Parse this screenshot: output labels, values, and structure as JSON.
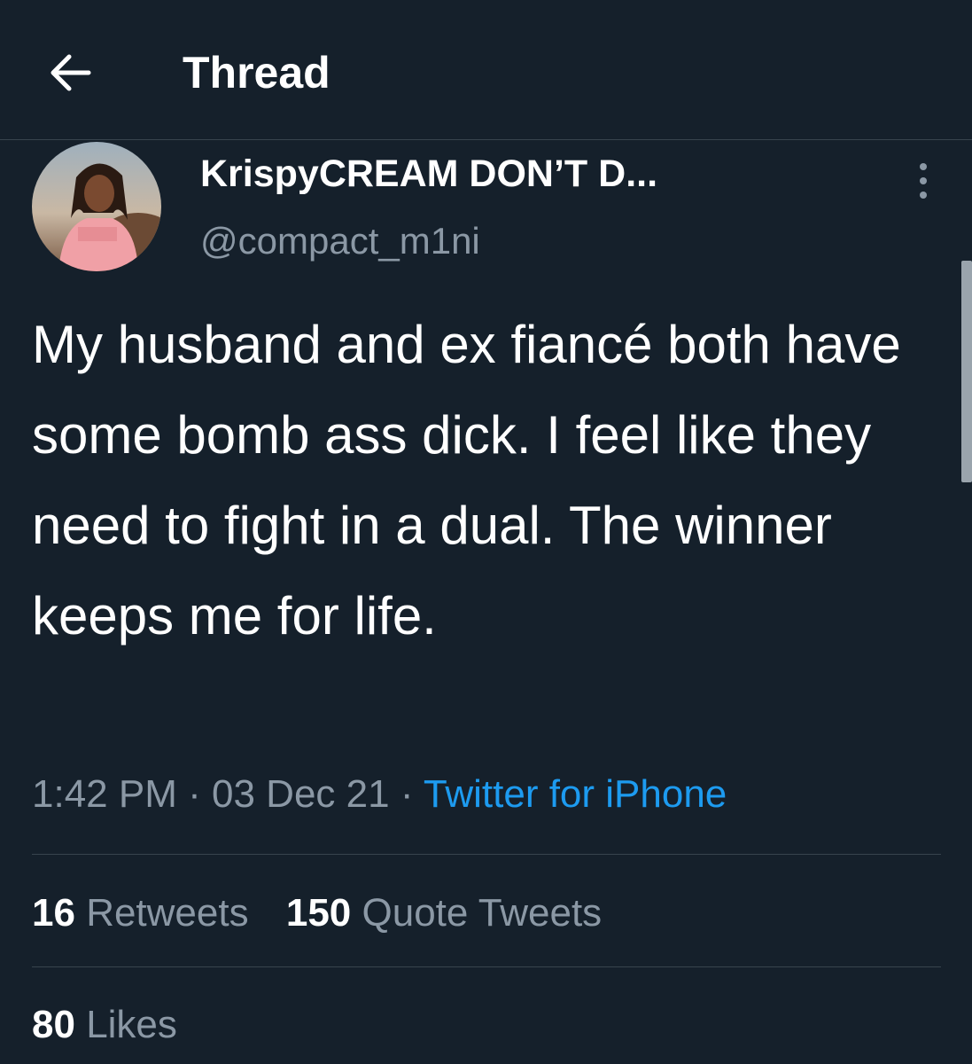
{
  "header": {
    "title": "Thread",
    "back_icon": "arrow-left-icon"
  },
  "author": {
    "display_name": "KrispyCREAM DON’T D...",
    "handle": "@compact_m1ni",
    "avatar_icon": "avatar-photo"
  },
  "tweet": {
    "text": "My husband and ex fiancé both have some bomb ass dick. I feel like they need to fight in a dual. The winner keeps me for life.",
    "time": "1:42 PM",
    "separator": "·",
    "date": "03 Dec 21",
    "source": "Twitter for iPhone"
  },
  "stats": {
    "retweets_count": "16",
    "retweets_label": "Retweets",
    "quotes_count": "150",
    "quotes_label": "Quote Tweets",
    "likes_count": "80",
    "likes_label": "Likes"
  },
  "colors": {
    "background": "#15202b",
    "text": "#ffffff",
    "secondary": "#8b98a5",
    "link": "#1d9bf0",
    "divider": "#38444d"
  }
}
